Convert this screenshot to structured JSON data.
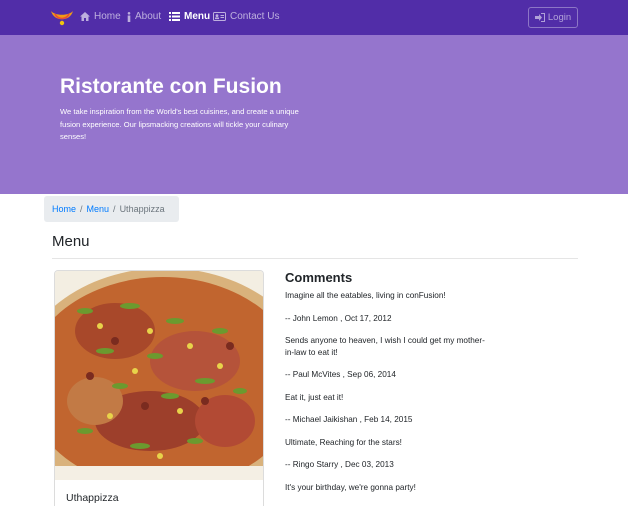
{
  "navbar": {
    "brand_icon": "confusion-logo-icon",
    "items": [
      {
        "label": "Home",
        "icon": "home-icon"
      },
      {
        "label": "About",
        "icon": "info-icon"
      },
      {
        "label": "Menu",
        "icon": "list-icon",
        "active": true
      },
      {
        "label": "Contact Us",
        "icon": "address-card-icon"
      }
    ],
    "login_label": "Login",
    "login_icon": "sign-in-icon"
  },
  "jumbotron": {
    "title": "Ristorante con Fusion",
    "text": "We take inspiration from the World's best cuisines, and create a unique fusion experience. Our lipsmacking creations will tickle your culinary senses!"
  },
  "breadcrumb": {
    "items": [
      "Home",
      "Menu"
    ],
    "active": "Uthappizza"
  },
  "page": {
    "heading": "Menu"
  },
  "dish": {
    "name": "Uthappizza"
  },
  "comments": {
    "title": "Comments",
    "items": [
      {
        "text": "Imagine all the eatables, living in conFusion!",
        "author_line": "-- John Lemon , Oct 17, 2012"
      },
      {
        "text": "Sends anyone to heaven, I wish I could get my mother-in-law to eat it!",
        "author_line": "-- Paul McVites , Sep 06, 2014"
      },
      {
        "text": "Eat it, just eat it!",
        "author_line": "-- Michael Jaikishan , Feb 14, 2015"
      },
      {
        "text": "Ultimate, Reaching for the stars!",
        "author_line": "-- Ringo Starry , Dec 03, 2013"
      },
      {
        "text": "It's your birthday, we're gonna party!"
      }
    ]
  },
  "colors": {
    "navbar": "#512da8",
    "jumbotron": "#9575cd",
    "link": "#007bff"
  }
}
